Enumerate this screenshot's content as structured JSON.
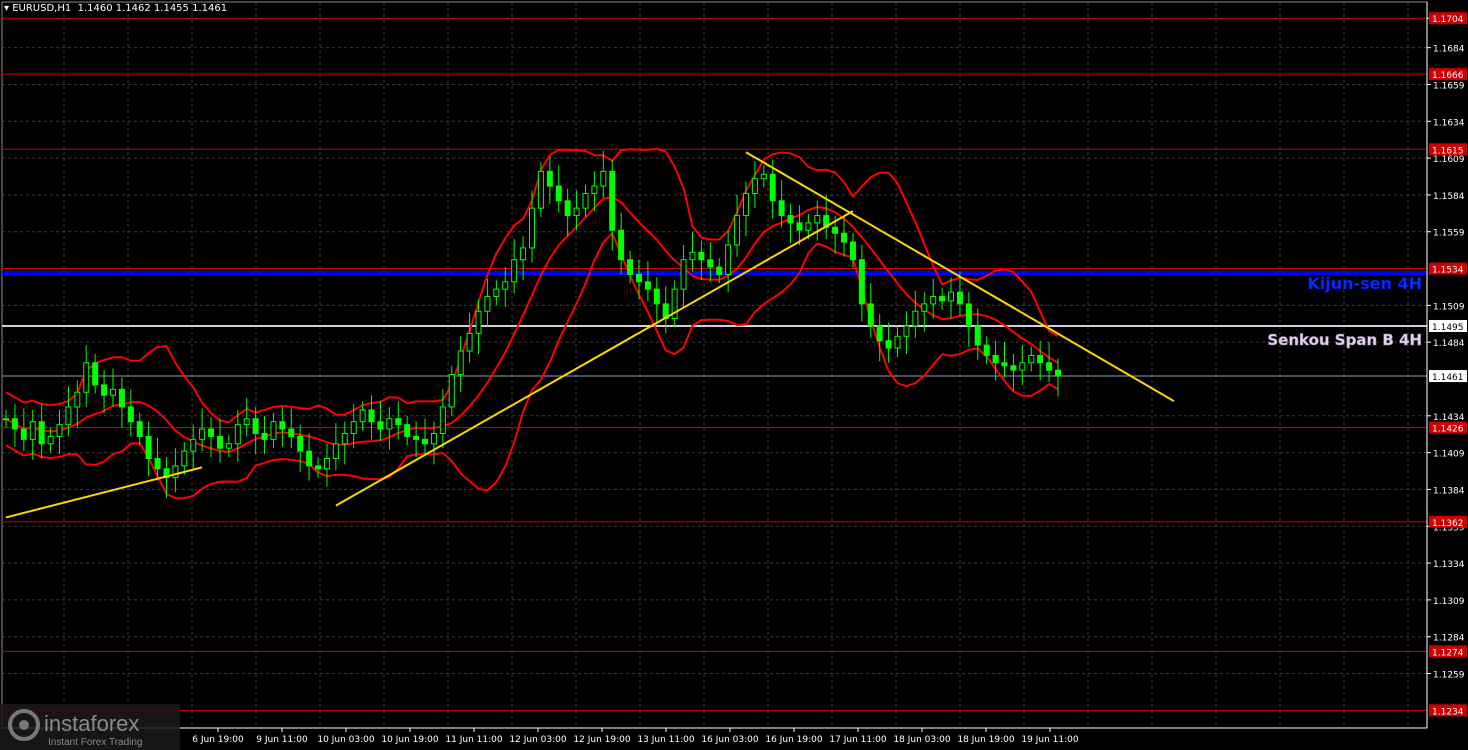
{
  "header": {
    "symbol": "EURUSD,H1",
    "ohlc": "1.1460 1.1462 1.1455 1.1461"
  },
  "colors": {
    "background": "#000000",
    "grid": "#3a3a3a",
    "candle": "#00ff00",
    "bollinger": "#ff0000",
    "trendline": "#ffd700",
    "kijun": "#0000ff",
    "senkou": "#d8c8e0",
    "level": "#cc0000",
    "price_line": "#8aa0b0",
    "axis_text": "#ffffff"
  },
  "watermark": {
    "brand": "instaforex",
    "tagline": "Instant Forex Trading"
  },
  "chart_data": {
    "type": "candlestick",
    "symbol": "EURUSD",
    "timeframe": "H1",
    "ylim": [
      1.1222,
      1.1715
    ],
    "y_ticks": [
      "1.1704",
      "1.1684",
      "1.1659",
      "1.1634",
      "1.1609",
      "1.1584",
      "1.1559",
      "1.1509",
      "1.1484",
      "1.1434",
      "1.1409",
      "1.1384",
      "1.1359",
      "1.1334",
      "1.1309",
      "1.1284",
      "1.1259"
    ],
    "x_ticks": [
      "6 Jun 19:00",
      "9 Jun 11:00",
      "10 Jun 03:00",
      "10 Jun 19:00",
      "11 Jun 11:00",
      "12 Jun 03:00",
      "12 Jun 19:00",
      "13 Jun 11:00",
      "16 Jun 03:00",
      "16 Jun 19:00",
      "17 Jun 11:00",
      "18 Jun 03:00",
      "18 Jun 19:00",
      "19 Jun 11:00"
    ],
    "horizontal_levels": [
      {
        "value": 1.1704,
        "label": "1.1704",
        "kind": "level"
      },
      {
        "value": 1.1666,
        "label": "1.1666",
        "kind": "level"
      },
      {
        "value": 1.1615,
        "label": "1.1615",
        "kind": "level"
      },
      {
        "value": 1.1534,
        "label": "1.1534",
        "kind": "level"
      },
      {
        "value": 1.1495,
        "label": "1.1495",
        "kind": "senkou"
      },
      {
        "value": 1.1461,
        "label": "1.1461",
        "kind": "price"
      },
      {
        "value": 1.1426,
        "label": "1.1426",
        "kind": "level"
      },
      {
        "value": 1.1362,
        "label": "1.1362",
        "kind": "level"
      },
      {
        "value": 1.1274,
        "label": "1.1274",
        "kind": "level"
      },
      {
        "value": 1.1234,
        "label": "1.1234",
        "kind": "level"
      }
    ],
    "kijun_sen": {
      "value": 1.1531,
      "label": "Kijun-sen 4H"
    },
    "senkou_span_b": {
      "value": 1.1495,
      "label": "Senkou Span B 4H"
    },
    "trendlines": [
      {
        "from": [
          0,
          1.1365
        ],
        "to": [
          22,
          1.1399
        ]
      },
      {
        "from": [
          37,
          1.1373
        ],
        "to": [
          95,
          1.1573
        ]
      },
      {
        "from": [
          83,
          1.1613
        ],
        "to": [
          131,
          1.1444
        ]
      }
    ],
    "closes": [
      1.1432,
      1.1425,
      1.1418,
      1.143,
      1.1415,
      1.142,
      1.1428,
      1.144,
      1.145,
      1.147,
      1.1455,
      1.1448,
      1.1452,
      1.144,
      1.143,
      1.142,
      1.1405,
      1.1398,
      1.1392,
      1.14,
      1.141,
      1.1418,
      1.1425,
      1.142,
      1.1412,
      1.1415,
      1.1428,
      1.1432,
      1.1422,
      1.1418,
      1.143,
      1.1425,
      1.142,
      1.141,
      1.14,
      1.1398,
      1.1405,
      1.1415,
      1.1422,
      1.143,
      1.1438,
      1.143,
      1.1425,
      1.1432,
      1.1428,
      1.142,
      1.1418,
      1.1415,
      1.1422,
      1.144,
      1.1462,
      1.1478,
      1.149,
      1.1505,
      1.1515,
      1.152,
      1.1525,
      1.154,
      1.1548,
      1.1575,
      1.16,
      1.159,
      1.158,
      1.157,
      1.1575,
      1.1585,
      1.159,
      1.16,
      1.156,
      1.154,
      1.153,
      1.1525,
      1.152,
      1.151,
      1.15,
      1.152,
      1.154,
      1.1545,
      1.154,
      1.1535,
      1.153,
      1.155,
      1.157,
      1.1585,
      1.1595,
      1.1598,
      1.158,
      1.157,
      1.1565,
      1.156,
      1.1565,
      1.157,
      1.1562,
      1.1558,
      1.1552,
      1.154,
      1.151,
      1.1495,
      1.1485,
      1.148,
      1.1488,
      1.1495,
      1.1505,
      1.151,
      1.1515,
      1.1512,
      1.1518,
      1.151,
      1.1495,
      1.1482,
      1.1475,
      1.147,
      1.1468,
      1.1465,
      1.147,
      1.1475,
      1.147,
      1.1465,
      1.1461
    ]
  }
}
